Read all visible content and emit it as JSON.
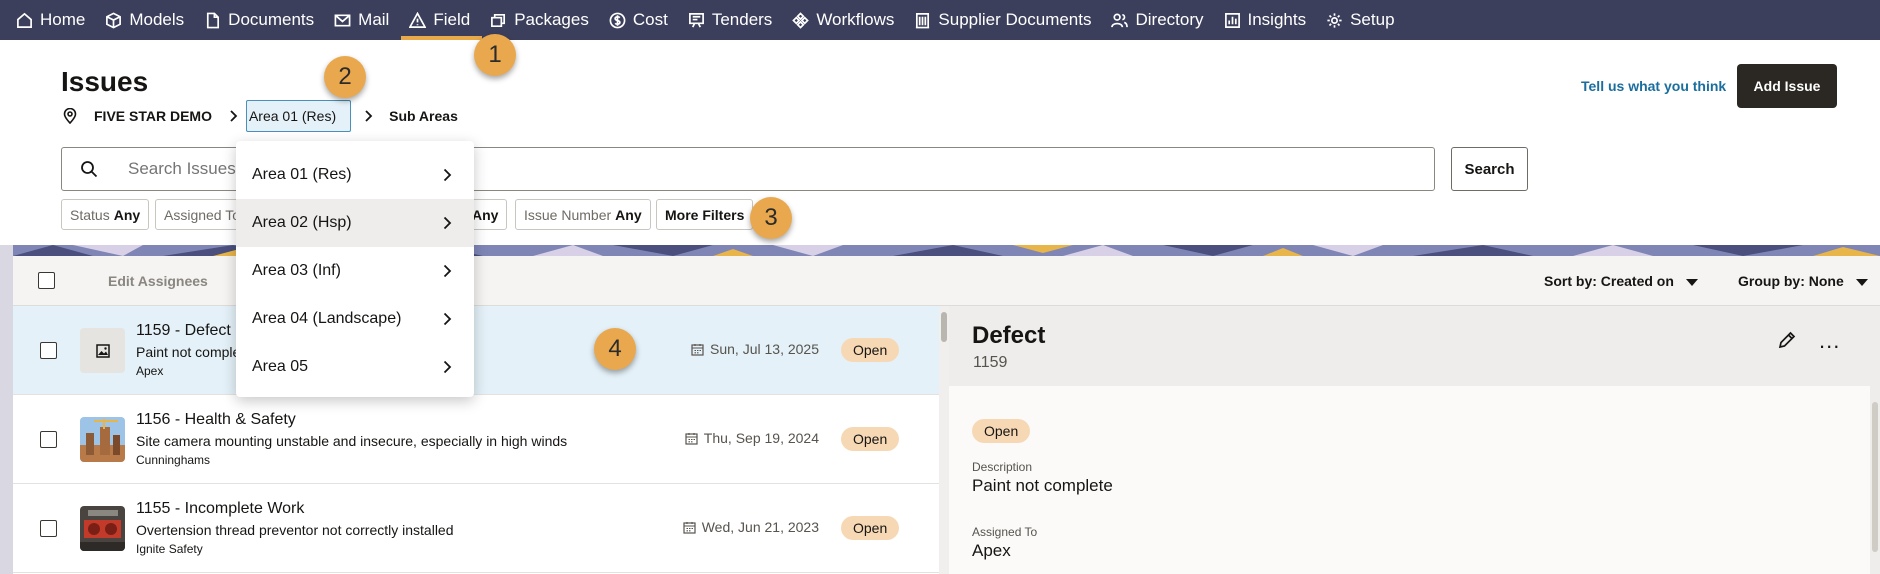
{
  "nav": {
    "items": [
      {
        "label": "Home",
        "icon": "home-icon"
      },
      {
        "label": "Models",
        "icon": "cube-icon"
      },
      {
        "label": "Documents",
        "icon": "document-icon"
      },
      {
        "label": "Mail",
        "icon": "mail-icon"
      },
      {
        "label": "Field",
        "icon": "warning-triangle-icon",
        "active": true
      },
      {
        "label": "Packages",
        "icon": "packages-icon"
      },
      {
        "label": "Cost",
        "icon": "cost-icon"
      },
      {
        "label": "Tenders",
        "icon": "tender-icon"
      },
      {
        "label": "Workflows",
        "icon": "workflow-icon"
      },
      {
        "label": "Supplier Documents",
        "icon": "building-icon"
      },
      {
        "label": "Directory",
        "icon": "people-icon"
      },
      {
        "label": "Insights",
        "icon": "chart-icon"
      },
      {
        "label": "Setup",
        "icon": "gear-icon"
      }
    ]
  },
  "callouts": [
    "1",
    "2",
    "3",
    "4"
  ],
  "header": {
    "title": "Issues",
    "feedback_link": "Tell us what you think",
    "add_button": "Add Issue"
  },
  "breadcrumb": {
    "project": "FIVE STAR DEMO",
    "area": "Area 01 (Res)",
    "sub": "Sub Areas"
  },
  "search": {
    "placeholder": "Search Issues",
    "button": "Search"
  },
  "filters": {
    "status_label": "Status",
    "status_value": "Any",
    "assigned_label": "Assigned To",
    "hidden_value": "Any",
    "issue_number_label": "Issue Number",
    "issue_number_value": "Any",
    "more": "More Filters"
  },
  "dropdown": {
    "items": [
      "Area 01 (Res)",
      "Area 02 (Hsp)",
      "Area 03 (Inf)",
      "Area 04 (Landscape)",
      "Area 05"
    ],
    "hovered_index": 1
  },
  "list": {
    "edit_assignees": "Edit Assignees",
    "sort_by": "Sort by: Created on",
    "group_by": "Group by: None",
    "rows": [
      {
        "title": "1159 - Defect",
        "description": "Paint not complete",
        "company": "Apex",
        "date": "Sun, Jul 13, 2025",
        "status": "Open"
      },
      {
        "title": "1156 - Health & Safety",
        "description": "Site camera mounting unstable and insecure, especially in high winds",
        "company": "Cunninghams",
        "date": "Thu, Sep 19, 2024",
        "status": "Open"
      },
      {
        "title": "1155 - Incomplete Work",
        "description": "Overtension thread preventor not correctly installed",
        "company": "Ignite Safety",
        "date": "Wed, Jun 21, 2023",
        "status": "Open"
      }
    ]
  },
  "detail": {
    "title": "Defect",
    "number": "1159",
    "status": "Open",
    "description_label": "Description",
    "description_value": "Paint not complete",
    "assigned_label": "Assigned To",
    "assigned_value": "Apex",
    "more": "..."
  },
  "colors": {
    "nav_bg": "#3b3f5c",
    "accent": "#e9a84e",
    "link": "#1a6e9e",
    "status_pill": "#f7d8b5",
    "selected_row": "#e4f1f8"
  }
}
